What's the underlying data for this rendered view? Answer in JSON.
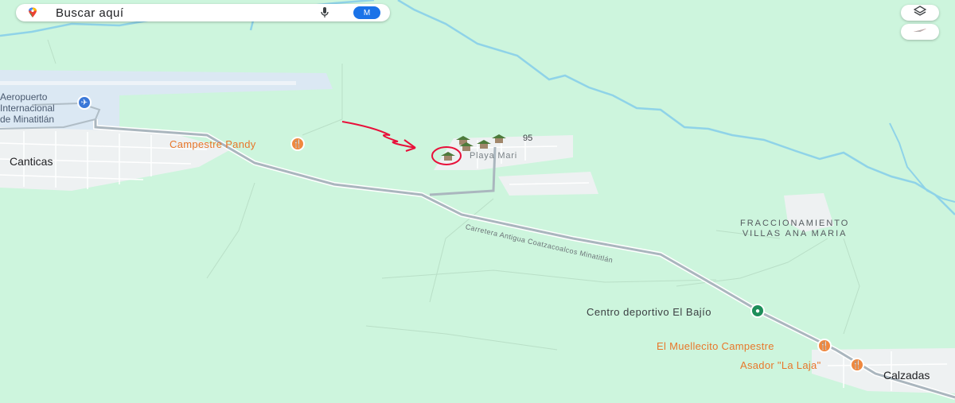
{
  "search": {
    "placeholder": "Buscar aquí",
    "avatar_letter": "M",
    "icons": [
      "google-maps-logo-icon",
      "microphone-icon"
    ]
  },
  "controls": {
    "icons": [
      "layers-icon",
      "compass-icon"
    ]
  },
  "places": {
    "airport": [
      "Aeropuerto",
      "Internacional",
      "de Minatitlán"
    ],
    "canticas": "Canticas",
    "campestre_pandy": "Campestre Pandy",
    "playa": "Playa Mari",
    "count": "95",
    "fraccionamiento": [
      "FRACCIONAMIENTO",
      "VILLAS ANA MARIA"
    ],
    "road": "Carretera Antigua Coatzacoalcos Minatitlán",
    "centro_deportivo": "Centro deportivo El Bajío",
    "muellecito": "El Muellecito Campestre",
    "asador": "Asador \"La Laja\"",
    "calzadas": "Calzadas"
  },
  "colors": {
    "land": "#cdf5dd",
    "urban": "#eef1f2",
    "road": "#aab6be",
    "river": "#8fd3e8",
    "poi_orange": "#e8772b",
    "annotation_red": "#e8103a"
  }
}
